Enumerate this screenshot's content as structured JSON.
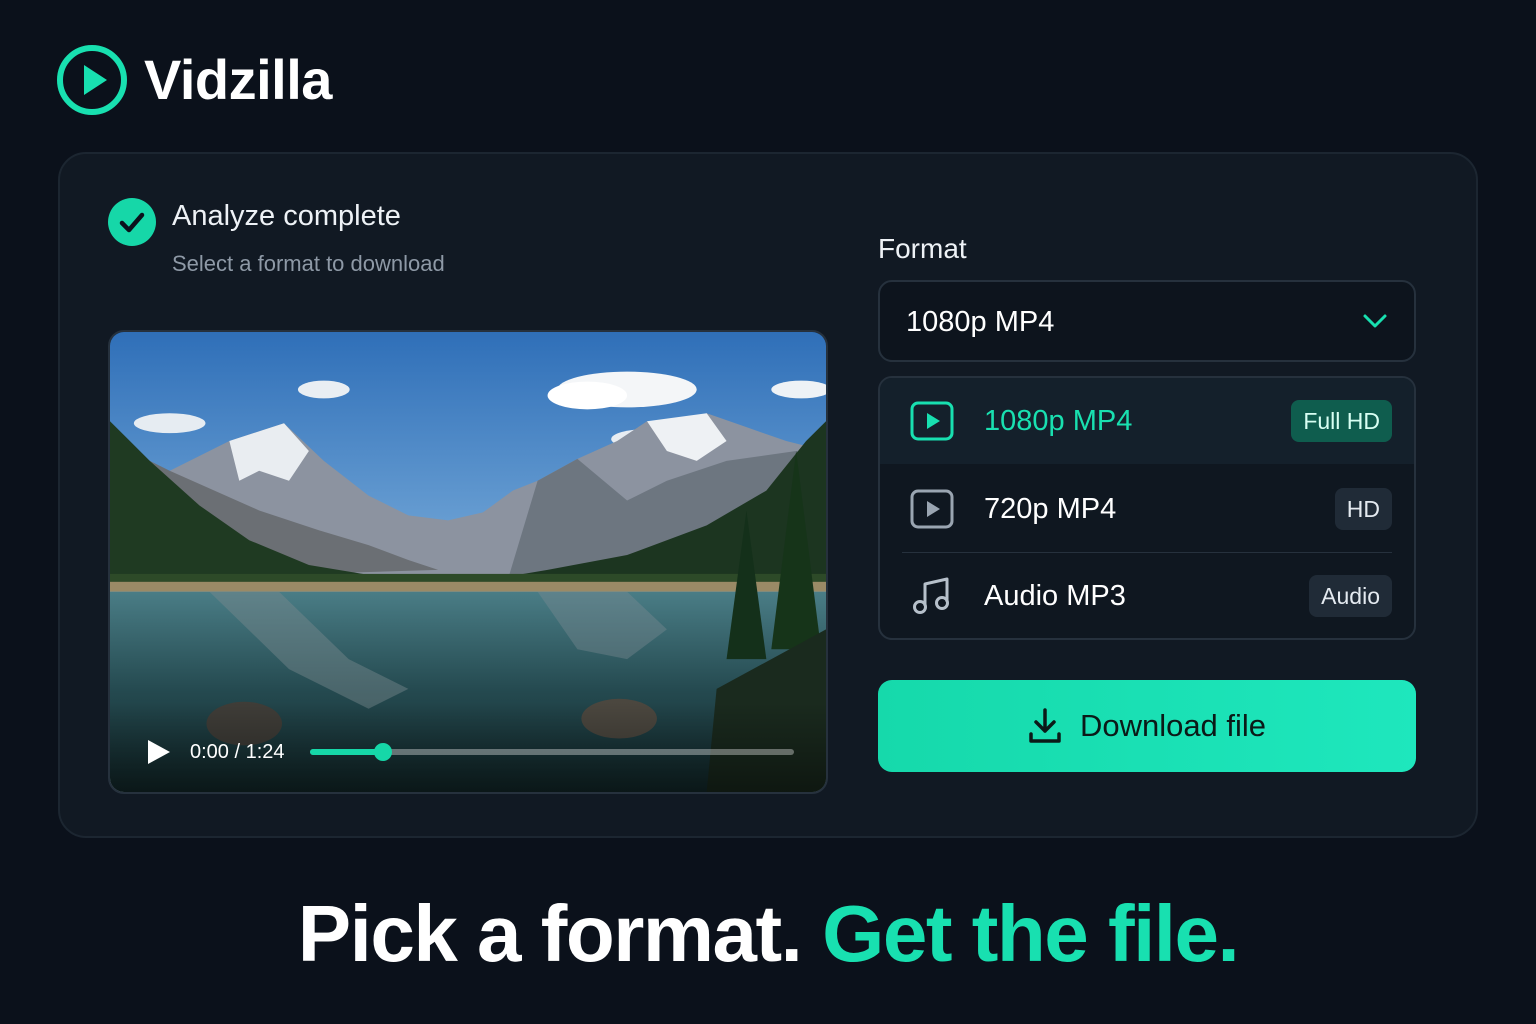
{
  "app": {
    "name": "Vidzilla"
  },
  "status": {
    "title": "Analyze complete",
    "subtitle": "Select a format to download"
  },
  "video": {
    "time": "0:00 / 1:24",
    "progress": 0.15
  },
  "format": {
    "label": "Format",
    "selected": "1080p MP4",
    "options": [
      {
        "label": "1080p MP4",
        "badge": "Full HD",
        "icon": "play-square-icon",
        "selected": true
      },
      {
        "label": "720p MP4",
        "badge": "HD",
        "icon": "play-square-icon",
        "selected": false
      },
      {
        "label": "Audio MP3",
        "badge": "Audio",
        "icon": "music-note-icon",
        "selected": false
      }
    ]
  },
  "download": {
    "label": "Download file"
  },
  "tagline": {
    "part1": "Pick a format.",
    "part2": "Get the file."
  },
  "colors": {
    "accent": "#18e0b0",
    "background": "#0b111b",
    "card": "#111923"
  }
}
